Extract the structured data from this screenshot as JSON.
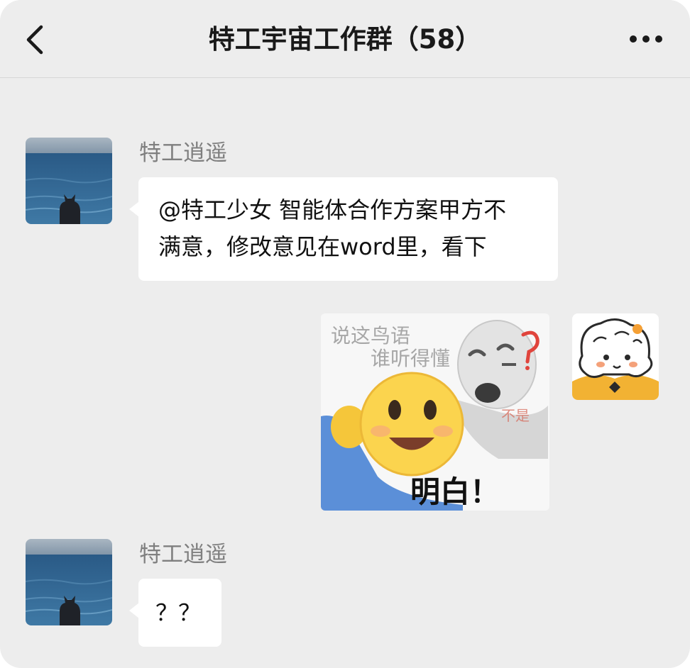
{
  "header": {
    "title": "特工宇宙工作群（58）"
  },
  "messages": [
    {
      "sender": "特工逍遥",
      "lines": [
        "@特工少女 智能体合作方案甲方不",
        "满意，修改意见在word里，看下"
      ]
    },
    {
      "sticker": {
        "line1": "说这鸟语",
        "line2": "谁听得懂",
        "caption": "明白！",
        "tiny": "不是"
      }
    },
    {
      "sender": "特工逍遥",
      "text": "？？"
    }
  ],
  "colors": {
    "background": "#ededed",
    "bubble": "#ffffff",
    "title": "#191919",
    "sender_name": "#7f7f7f"
  },
  "icons": [
    "back-chevron-icon",
    "more-dots-icon"
  ]
}
